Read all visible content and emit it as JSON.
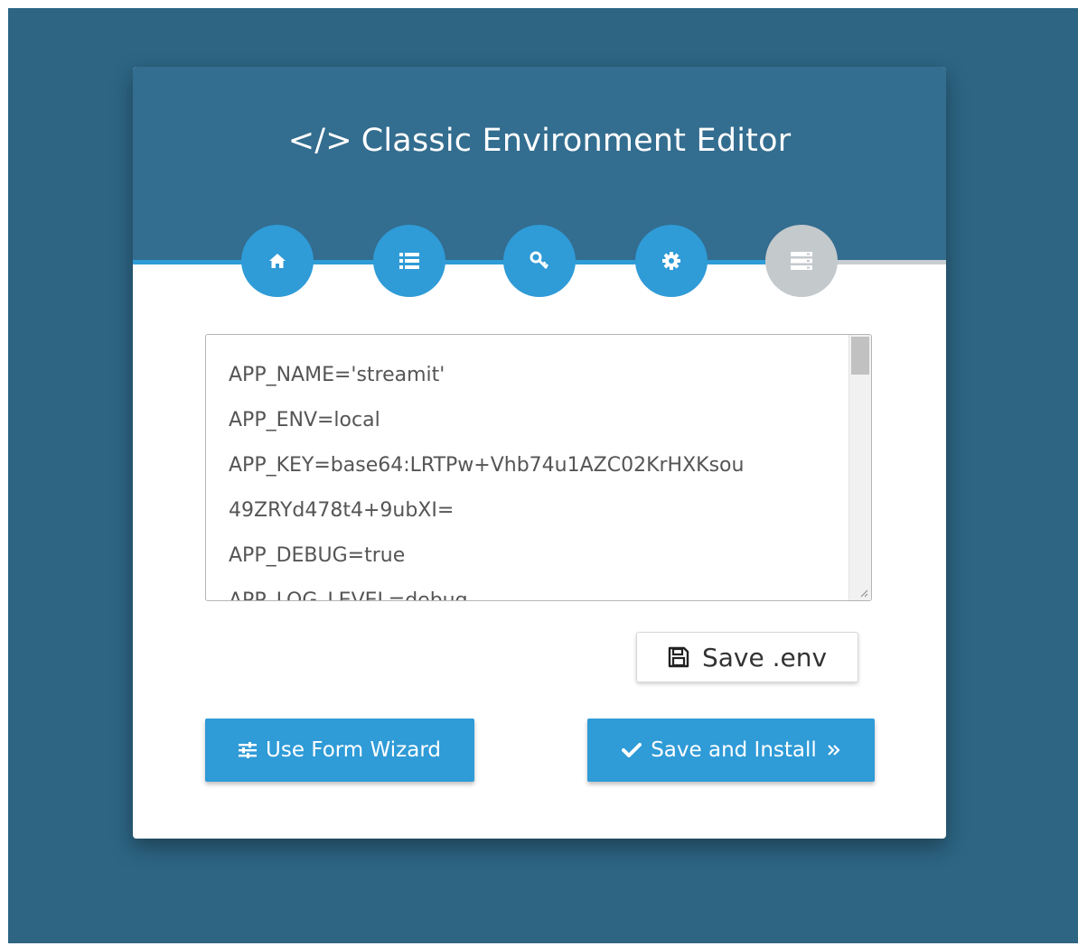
{
  "page": {
    "title": "Classic Environment Editor",
    "title_icon": "</>",
    "background_color": "#2d6583",
    "header_color": "#336d8f",
    "accent_color": "#2f9bd7",
    "inactive_color": "#c4c9cc"
  },
  "steps": [
    {
      "icon": "home-icon",
      "state": "complete"
    },
    {
      "icon": "list-icon",
      "state": "complete"
    },
    {
      "icon": "key-icon",
      "state": "complete"
    },
    {
      "icon": "gear-icon",
      "state": "active"
    },
    {
      "icon": "server-icon",
      "state": "inactive"
    }
  ],
  "editor": {
    "lines": [
      "APP_NAME='streamit'",
      "APP_ENV=local",
      "APP_KEY=base64:LRTPw+Vhb74u1AZC02KrHXKsou",
      "49ZRYd478t4+9ubXI=",
      "APP_DEBUG=true",
      "APP_LOG_LEVEL=debug"
    ]
  },
  "buttons": {
    "save_env": "Save .env",
    "use_form_wizard": "Use Form Wizard",
    "save_and_install": "Save and Install"
  }
}
